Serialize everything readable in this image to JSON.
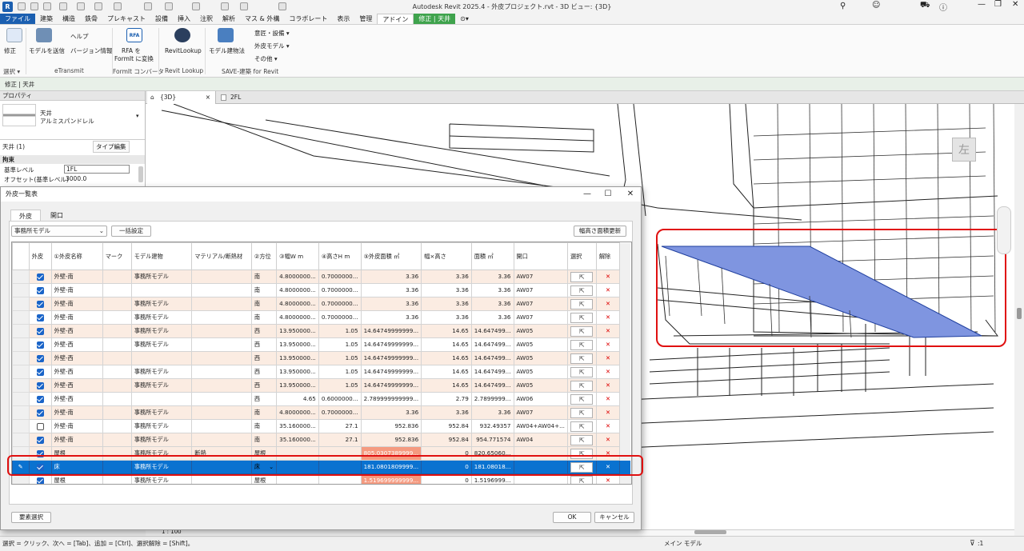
{
  "window": {
    "title": "Autodesk Revit 2025.4 - 外皮プロジェクト.rvt - 3D ビュー: {3D}",
    "logo": "R"
  },
  "ribbon_tabs": [
    "ファイル",
    "建築",
    "構造",
    "鉄骨",
    "プレキャスト",
    "設備",
    "挿入",
    "注釈",
    "解析",
    "マス & 外構",
    "コラボレート",
    "表示",
    "管理",
    "アドイン",
    "修正 | 天井"
  ],
  "ribbon": {
    "modify": "修正",
    "select": "選択",
    "send_model": "モデルを送信",
    "help": "ヘルプ",
    "version_info": "バージョン情報",
    "etransmit": "eTransmit",
    "rfa_line1": "RFA を",
    "rfa_line2": "FormIt に変換",
    "rfa_icon": "RFA",
    "formit_converter": "FormIt コンバータ",
    "revitlookup": "RevitLookup",
    "revitlookup_group": "Revit Lookup",
    "model_method": "モデル建物法",
    "save_group": "SAVE-建築 for Revit",
    "menu1": "意匠・設備",
    "menu2": "外皮モデル",
    "menu3": "その他"
  },
  "option_bar": "修正 | 天井",
  "properties": {
    "header": "プロパティ",
    "type_name": "天井",
    "type_sub": "アルミスパンドレル",
    "instance": "天井 (1)",
    "edit_type": "タイプ編集",
    "section": "拘束",
    "rows": [
      {
        "label": "基準レベル",
        "value": "1FL"
      },
      {
        "label": "オフセット(基準レベル)",
        "value": "3000.0"
      }
    ]
  },
  "view_tabs": [
    {
      "label": "{3D}",
      "close": "×"
    },
    {
      "label": "2FL",
      "close": ""
    }
  ],
  "viewcube": "左",
  "status": {
    "text": "選択 = クリック、次へ = [Tab]、追加 = [Ctrl]、選択解除 = [Shift]。",
    "scale": "1 : 100",
    "main_model": "メイン モデル",
    "filter_count": ":1"
  },
  "dialog": {
    "title": "外皮一覧表",
    "tabs": [
      "外皮",
      "開口"
    ],
    "model_select": "事務所モデル",
    "bulk_setting": "一括設定",
    "update_area": "幅高さ面積更新",
    "element_select": "要素選択",
    "ok": "OK",
    "cancel": "キャンセル",
    "columns": [
      "外皮",
      "①外皮名称",
      "マーク",
      "モデル建物",
      "マテリアル/断熱材",
      "②方位",
      "③幅W m",
      "④高さH m",
      "⑤外皮面積 ㎡",
      "幅×高さ",
      "面積 ㎡",
      "開口",
      "選択",
      "解除"
    ],
    "rows": [
      {
        "check": true,
        "name": "外壁-南",
        "mark": "",
        "model": "事務所モデル",
        "mat": "",
        "dir": "南",
        "w": "4.8000000...",
        "h": "0.7000000...",
        "area": "3.36",
        "wh": "3.36",
        "face": "3.36",
        "open": "AW07",
        "state": "alt"
      },
      {
        "check": true,
        "name": "外壁-南",
        "mark": "",
        "model": "",
        "mat": "",
        "dir": "南",
        "w": "4.8000000...",
        "h": "0.7000000...",
        "area": "3.36",
        "wh": "3.36",
        "face": "3.36",
        "open": "AW07",
        "state": "norm"
      },
      {
        "check": true,
        "name": "外壁-南",
        "mark": "",
        "model": "事務所モデル",
        "mat": "",
        "dir": "南",
        "w": "4.8000000...",
        "h": "0.7000000...",
        "area": "3.36",
        "wh": "3.36",
        "face": "3.36",
        "open": "AW07",
        "state": "alt"
      },
      {
        "check": true,
        "name": "外壁-南",
        "mark": "",
        "model": "事務所モデル",
        "mat": "",
        "dir": "南",
        "w": "4.8000000...",
        "h": "0.7000000...",
        "area": "3.36",
        "wh": "3.36",
        "face": "3.36",
        "open": "AW07",
        "state": "norm"
      },
      {
        "check": true,
        "name": "外壁-西",
        "mark": "",
        "model": "事務所モデル",
        "mat": "",
        "dir": "西",
        "w": "13.950000...",
        "h": "1.05",
        "area": "14.64749999999...",
        "wh": "14.65",
        "face": "14.647499...",
        "open": "AW05",
        "state": "alt"
      },
      {
        "check": true,
        "name": "外壁-西",
        "mark": "",
        "model": "事務所モデル",
        "mat": "",
        "dir": "西",
        "w": "13.950000...",
        "h": "1.05",
        "area": "14.64749999999...",
        "wh": "14.65",
        "face": "14.647499...",
        "open": "AW05",
        "state": "norm"
      },
      {
        "check": true,
        "name": "外壁-西",
        "mark": "",
        "model": "",
        "mat": "",
        "dir": "西",
        "w": "13.950000...",
        "h": "1.05",
        "area": "14.64749999999...",
        "wh": "14.65",
        "face": "14.647499...",
        "open": "AW05",
        "state": "alt"
      },
      {
        "check": true,
        "name": "外壁-西",
        "mark": "",
        "model": "事務所モデル",
        "mat": "",
        "dir": "西",
        "w": "13.950000...",
        "h": "1.05",
        "area": "14.64749999999...",
        "wh": "14.65",
        "face": "14.647499...",
        "open": "AW05",
        "state": "norm"
      },
      {
        "check": true,
        "name": "外壁-西",
        "mark": "",
        "model": "事務所モデル",
        "mat": "",
        "dir": "西",
        "w": "13.950000...",
        "h": "1.05",
        "area": "14.64749999999...",
        "wh": "14.65",
        "face": "14.647499...",
        "open": "AW05",
        "state": "alt"
      },
      {
        "check": true,
        "name": "外壁-西",
        "mark": "",
        "model": "",
        "mat": "",
        "dir": "西",
        "w": "4.65",
        "h": "0.6000000...",
        "area": "2.789999999999...",
        "wh": "2.79",
        "face": "2.7899999...",
        "open": "AW06",
        "state": "norm"
      },
      {
        "check": true,
        "name": "外壁-南",
        "mark": "",
        "model": "事務所モデル",
        "mat": "",
        "dir": "南",
        "w": "4.8000000...",
        "h": "0.7000000...",
        "area": "3.36",
        "wh": "3.36",
        "face": "3.36",
        "open": "AW07",
        "state": "alt"
      },
      {
        "check": false,
        "name": "外壁-南",
        "mark": "",
        "model": "事務所モデル",
        "mat": "",
        "dir": "南",
        "w": "35.160000...",
        "h": "27.1",
        "area": "952.836",
        "wh": "952.84",
        "face": "932.49357",
        "open": "AW04+AW04+...",
        "state": "norm"
      },
      {
        "check": true,
        "name": "外壁-南",
        "mark": "",
        "model": "事務所モデル",
        "mat": "",
        "dir": "南",
        "w": "35.160000...",
        "h": "27.1",
        "area": "952.836",
        "wh": "952.84",
        "face": "954.771574",
        "open": "AW04",
        "state": "alt"
      },
      {
        "check": true,
        "name": "屋根",
        "mark": "",
        "model": "事務所モデル",
        "mat": "断熱",
        "dir": "屋根",
        "w": "",
        "h": "",
        "area": "805.0307389999...",
        "wh": "0",
        "face": "820.65060...",
        "open": "",
        "state": "alt",
        "hl": true
      },
      {
        "check": true,
        "name": "床",
        "mark": "",
        "model": "事務所モデル",
        "mat": "",
        "dir": "床",
        "w": "",
        "h": "",
        "area": "181.0801809999...",
        "wh": "0",
        "face": "181.08018...",
        "open": "",
        "state": "sel",
        "dropdown": true,
        "pencil": "✎"
      },
      {
        "check": true,
        "name": "屋根",
        "mark": "",
        "model": "事務所モデル",
        "mat": "",
        "dir": "屋根",
        "w": "",
        "h": "",
        "area": "1.519699999999...",
        "wh": "0",
        "face": "1.5196999...",
        "open": "",
        "state": "norm",
        "hl": true
      }
    ]
  },
  "colors": {
    "accent": "#1b5fb0",
    "context_tab": "#3fa34d",
    "selection": "#0a72d0",
    "highlight_cell": "#f59a80",
    "row_alt": "#fbece2",
    "callout": "#e01010",
    "floor_fill": "#7f95e0"
  }
}
